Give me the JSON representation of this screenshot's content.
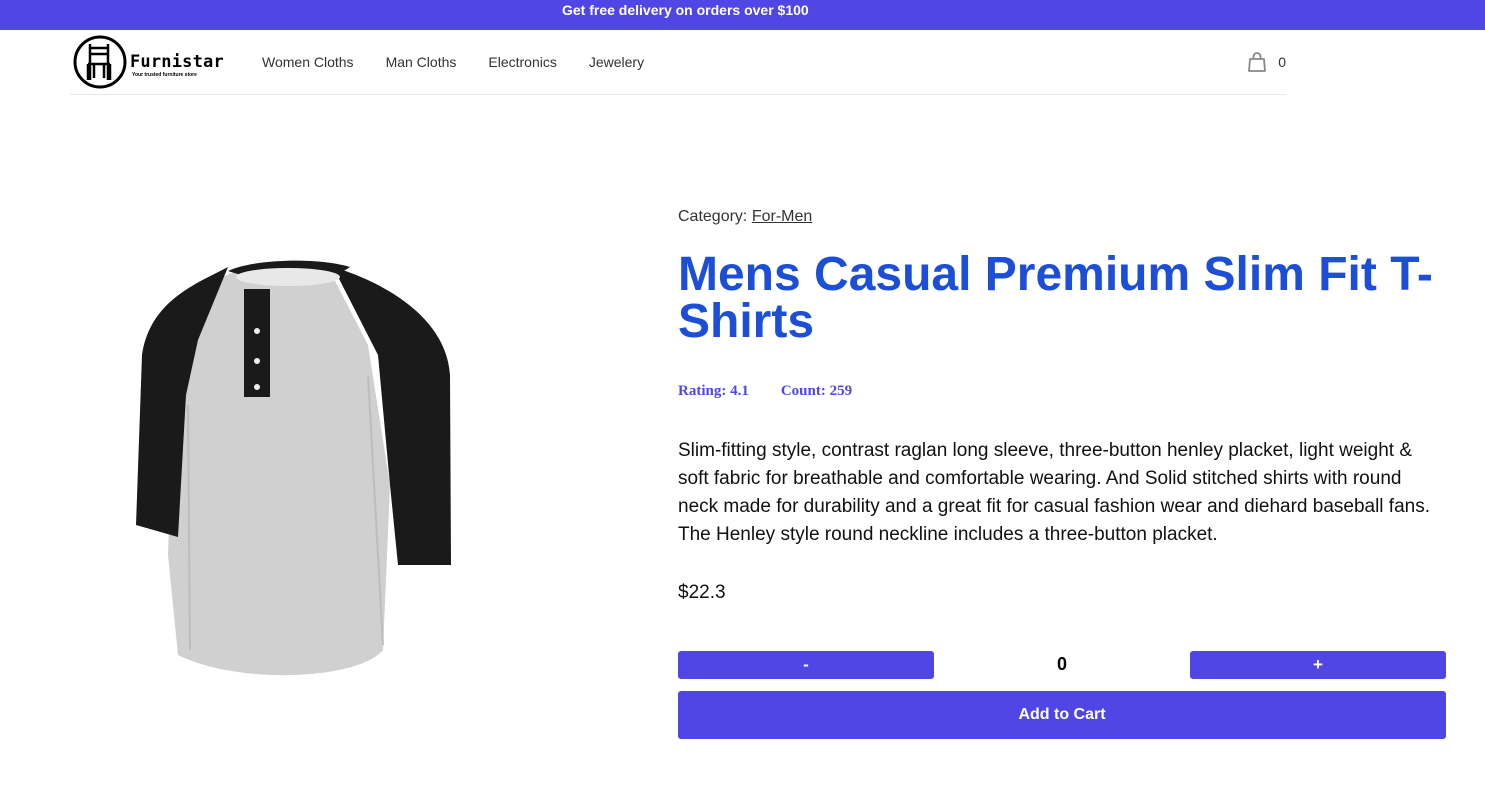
{
  "promo_bar": {
    "text": "Get free delivery on orders over $100",
    "background": "#4f46e5"
  },
  "header": {
    "logo": {
      "name": "Furnistar",
      "tagline": "Your trusted furniture store",
      "icon": "chair-icon"
    },
    "nav": [
      {
        "label": "Women Cloths"
      },
      {
        "label": "Man Cloths"
      },
      {
        "label": "Electronics"
      },
      {
        "label": "Jewelery"
      }
    ],
    "cart": {
      "icon": "shopping-bag-icon",
      "count": "0"
    }
  },
  "product": {
    "image_icon": "raglan-tshirt-image",
    "category_label": "Category:",
    "category": "For-Men",
    "title": "Mens Casual Premium Slim Fit T-Shirts",
    "title_color": "#1d4ed8",
    "rating_text": "Rating: 4.1",
    "count_text": "Count: 259",
    "description": "Slim-fitting style, contrast raglan long sleeve, three-button henley placket, light weight & soft fabric for breathable and comfortable wearing. And Solid stitched shirts with round neck made for durability and a great fit for casual fashion wear and diehard baseball fans. The Henley style round neckline includes a three-button placket.",
    "price": "$22.3"
  },
  "quantity": {
    "decrement_label": "-",
    "value": "0",
    "increment_label": "+"
  },
  "add_to_cart_label": "Add to Cart",
  "accent_color": "#4f46e5"
}
